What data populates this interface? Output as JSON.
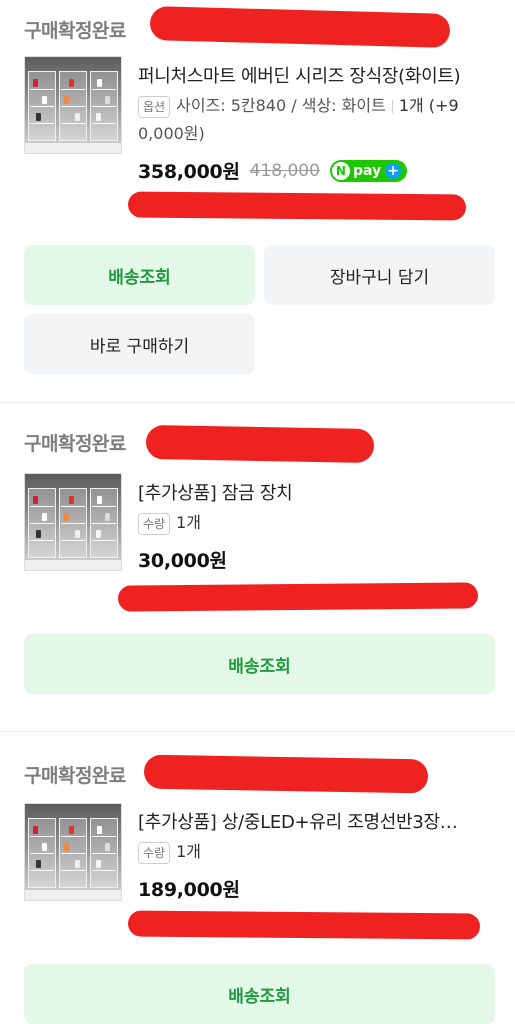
{
  "orders": [
    {
      "status": "구매확정완료",
      "title": "퍼니처스마트 에버딘 시리즈 장식장(화이트)",
      "option_badge": "옵션",
      "option_text": "사이즈: 5칸840 / 색상: 화이트",
      "quantity_text": "1개 (+9",
      "option_line2": "0,000원)",
      "price": "358,000원",
      "old_price": "418,000",
      "npay_label": "pay",
      "buttons": [
        "배송조회",
        "장바구니 담기",
        "바로 구매하기"
      ]
    },
    {
      "status": "구매확정완료",
      "title": "[추가상품] 잠금 장치",
      "option_badge": "수량",
      "quantity_text": "1개",
      "price": "30,000원",
      "buttons": [
        "배송조회"
      ]
    },
    {
      "status": "구매확정완료",
      "title": "[추가상품] 상/중LED+유리 조명선반3장…",
      "option_badge": "수량",
      "quantity_text": "1개",
      "price": "189,000원",
      "buttons": [
        "배송조회"
      ]
    }
  ],
  "icons": {
    "npay_logo": "naver-pay-logo",
    "npay_plus": "plus-icon",
    "thumbnail": "display-cabinet-photo"
  },
  "colors": {
    "accent_green": "#1f9a3e",
    "green_button_bg": "#e4f8e7",
    "gray_button_bg": "#f2f4f5",
    "redaction": "#ee1b1b",
    "npay_green": "#1ec800"
  }
}
